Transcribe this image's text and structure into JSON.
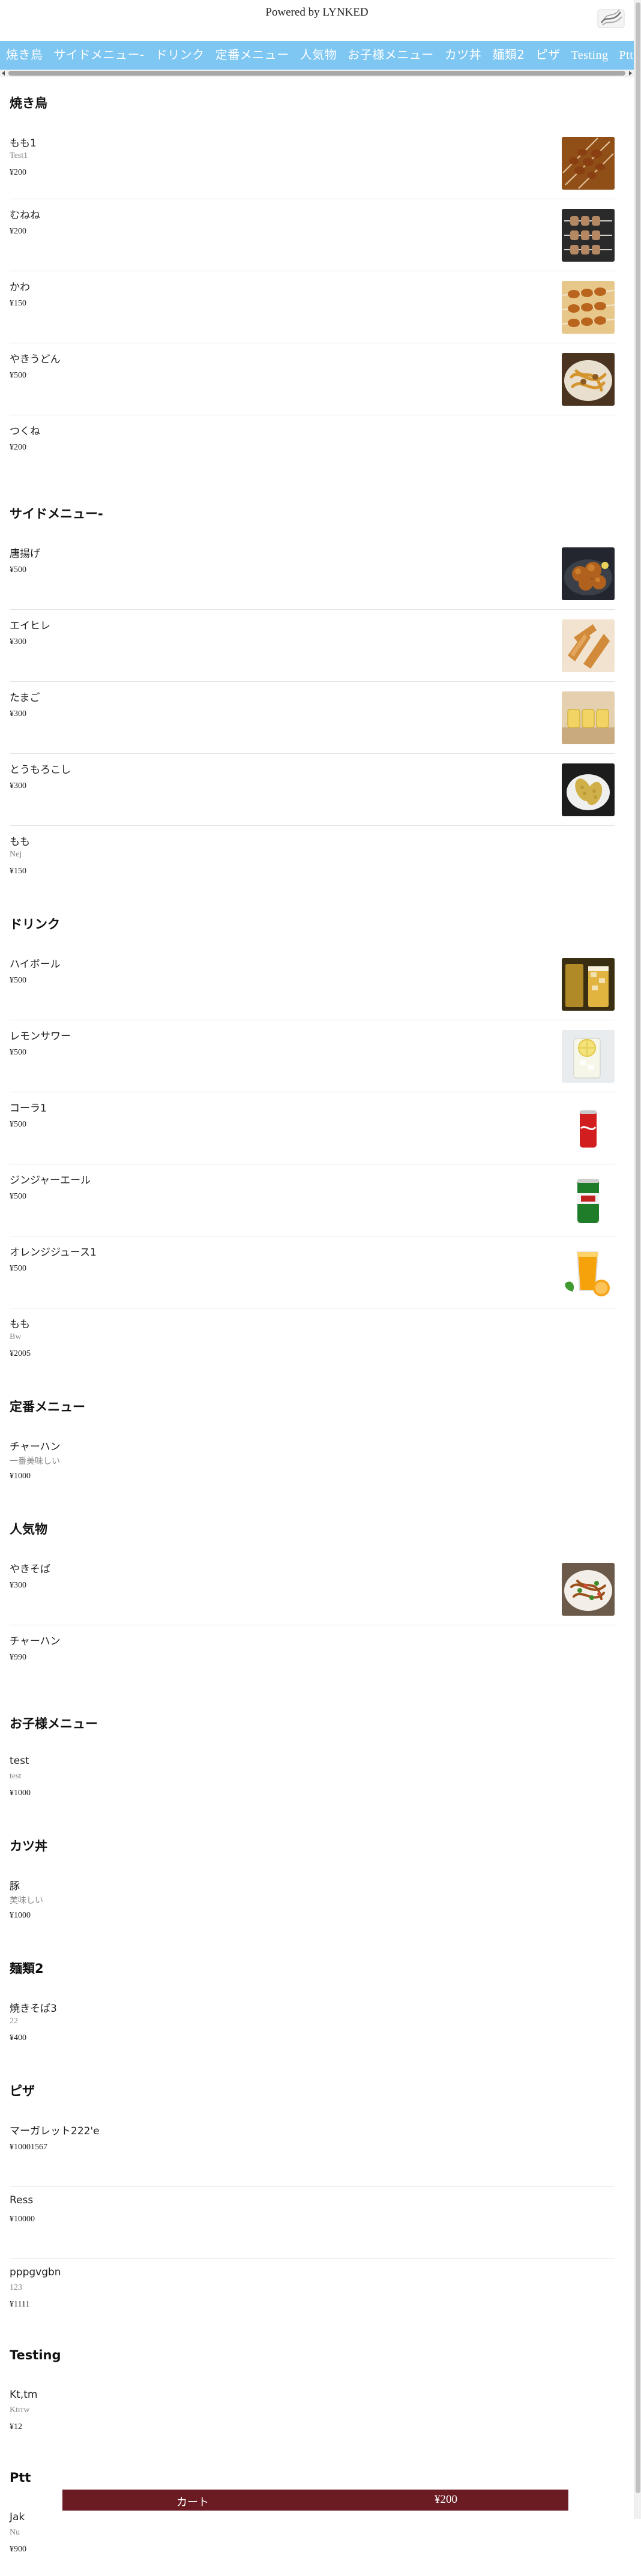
{
  "header": {
    "powered_by": "Powered by LYNKED"
  },
  "nav": {
    "tabs": [
      {
        "label": "焼き鳥"
      },
      {
        "label": "サイドメニュー-"
      },
      {
        "label": "ドリンク"
      },
      {
        "label": "定番メニュー"
      },
      {
        "label": "人気物"
      },
      {
        "label": "お子様メニュー"
      },
      {
        "label": "カツ丼"
      },
      {
        "label": "麺類2"
      },
      {
        "label": "ピザ"
      },
      {
        "label": "Testing"
      },
      {
        "label": "Ptt"
      }
    ]
  },
  "sections": [
    {
      "title": "焼き鳥",
      "items": [
        {
          "name": "もも1",
          "desc": "Test1",
          "price": "¥200",
          "image": "skewers-photo"
        },
        {
          "name": "むねね",
          "price": "¥200",
          "image": "grilled-skewers-photo"
        },
        {
          "name": "かわ",
          "price": "¥150",
          "image": "chicken-skin-photo"
        },
        {
          "name": "やきうどん",
          "price": "¥500",
          "image": "yaki-udon-photo"
        },
        {
          "name": "つくね",
          "price": "¥200"
        }
      ]
    },
    {
      "title": "サイドメニュー-",
      "items": [
        {
          "name": "唐揚げ",
          "price": "¥500",
          "image": "karaage-photo"
        },
        {
          "name": "エイヒレ",
          "price": "¥300",
          "image": "eihire-photo"
        },
        {
          "name": "たまご",
          "price": "¥300",
          "image": "tamago-photo"
        },
        {
          "name": "とうもろこし",
          "price": "¥300",
          "image": "corn-photo"
        },
        {
          "name": "もも",
          "desc": "Nej",
          "price": "¥150"
        }
      ]
    },
    {
      "title": "ドリンク",
      "items": [
        {
          "name": "ハイボール",
          "price": "¥500",
          "image": "highball-photo"
        },
        {
          "name": "レモンサワー",
          "price": "¥500",
          "image": "lemon-sour-photo"
        },
        {
          "name": "コーラ1",
          "price": "¥500",
          "image": "cola-can-photo"
        },
        {
          "name": "ジンジャーエール",
          "price": "¥500",
          "image": "ginger-ale-can-photo"
        },
        {
          "name": "オレンジジュース1",
          "price": "¥500",
          "image": "orange-juice-photo"
        },
        {
          "name": "もも",
          "desc": "Bw",
          "price": "¥2005"
        }
      ]
    },
    {
      "title": "定番メニュー",
      "items": [
        {
          "name": "チャーハン",
          "desc": "一番美味しい",
          "price": "¥1000"
        }
      ]
    },
    {
      "title": "人気物",
      "items": [
        {
          "name": "やきそば",
          "price": "¥300",
          "image": "yakisoba-photo"
        },
        {
          "name": "チャーハン",
          "price": "¥990"
        }
      ]
    },
    {
      "title": "お子様メニュー",
      "items": [
        {
          "name": "test",
          "desc": "test",
          "price": "¥1000"
        }
      ]
    },
    {
      "title": "カツ丼",
      "items": [
        {
          "name": "豚",
          "desc": "美味しい",
          "price": "¥1000"
        }
      ]
    },
    {
      "title": "麺類2",
      "items": [
        {
          "name": "焼きそば3",
          "desc": "22",
          "price": "¥400"
        }
      ]
    },
    {
      "title": "ピザ",
      "items": [
        {
          "name": "マーガレット222'e",
          "price": "¥10001567"
        },
        {
          "name": "Ress",
          "price": "¥10000"
        },
        {
          "name": "pppgvgbn",
          "desc": "123",
          "price": "¥1111"
        }
      ]
    },
    {
      "title": "Testing",
      "items": [
        {
          "name": "Kt,tm",
          "desc": "Ktrrw",
          "price": "¥12"
        }
      ]
    },
    {
      "title": "Ptt",
      "items": [
        {
          "name": "Jak",
          "desc": "Nu",
          "price": "¥900"
        }
      ]
    }
  ],
  "cart": {
    "label": "カート",
    "total": "¥200"
  },
  "colors": {
    "nav_bg": "#7fc7f3",
    "cart_bg": "#6b1b22"
  }
}
